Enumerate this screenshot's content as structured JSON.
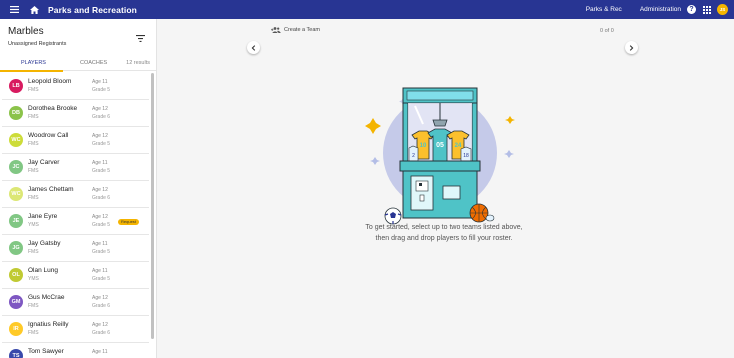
{
  "header": {
    "app_title": "Parks and Recreation",
    "org_label": "Parks & Rec",
    "admin_label": "Administration",
    "help_label": "?",
    "user_initials": "JS"
  },
  "sidebar": {
    "group_title": "Marbles",
    "group_subtitle": "Unassigned Registrants",
    "tabs": {
      "players": "PLAYERS",
      "coaches": "COACHES"
    },
    "results": "12 results",
    "players": [
      {
        "initials": "LB",
        "name": "Leopold Bloom",
        "school": "FMS",
        "age": "Age 11",
        "grade": "Grade 5",
        "color": "#d81b60"
      },
      {
        "initials": "DB",
        "name": "Dorothea Brooke",
        "school": "FMS",
        "age": "Age 12",
        "grade": "Grade 6",
        "color": "#8bc34a"
      },
      {
        "initials": "WC",
        "name": "Woodrow Call",
        "school": "FMS",
        "age": "Age 12",
        "grade": "Grade 5",
        "color": "#cddc39"
      },
      {
        "initials": "JC",
        "name": "Jay Carver",
        "school": "FMS",
        "age": "Age 11",
        "grade": "Grade 5",
        "color": "#81c784"
      },
      {
        "initials": "WC",
        "name": "James Chettam",
        "school": "FMS",
        "age": "Age 12",
        "grade": "Grade 6",
        "color": "#dce775"
      },
      {
        "initials": "JE",
        "name": "Jane Eyre",
        "school": "YMS",
        "age": "Age 12",
        "grade": "Grade 5",
        "color": "#81c784",
        "badge": "Request"
      },
      {
        "initials": "JG",
        "name": "Jay Gatsby",
        "school": "FMS",
        "age": "Age 11",
        "grade": "Grade 5",
        "color": "#81c784"
      },
      {
        "initials": "OL",
        "name": "Olan Lung",
        "school": "YMS",
        "age": "Age 11",
        "grade": "Grade 5",
        "color": "#c0ca33"
      },
      {
        "initials": "GM",
        "name": "Gus McCrae",
        "school": "FMS",
        "age": "Age 12",
        "grade": "Grade 6",
        "color": "#7e57c2"
      },
      {
        "initials": "IR",
        "name": "Ignatius Reilly",
        "school": "FMS",
        "age": "Age 12",
        "grade": "Grade 6",
        "color": "#ffca28"
      },
      {
        "initials": "TS",
        "name": "Tom Sawyer",
        "school": "",
        "age": "Age 11",
        "grade": "",
        "color": "#3949ab"
      }
    ]
  },
  "main": {
    "create_team_label": "Create a Team",
    "counter": "0 of 0",
    "hint_line1": "To get started, select up to two teams listed above,",
    "hint_line2": "then drag and drop players to fill your roster.",
    "illustration_numbers": [
      "10",
      "05",
      "24",
      "2",
      "18"
    ]
  },
  "colors": {
    "header": "#283593",
    "accent": "#f4b400",
    "machine_teal": "#4fc3c7",
    "circle": "#c5cae9"
  },
  "icons": [
    "menu-icon",
    "home-icon",
    "help-icon",
    "apps-grid-icon",
    "filter-icon",
    "add-group-icon",
    "chevron-left-icon",
    "chevron-right-icon"
  ]
}
